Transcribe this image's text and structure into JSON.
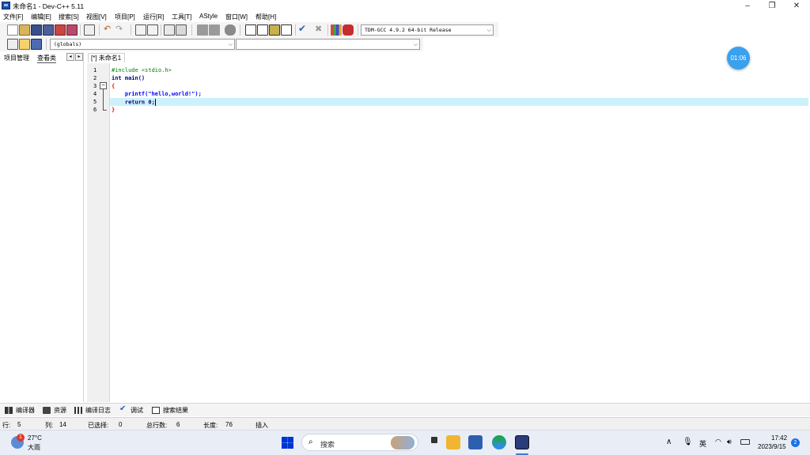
{
  "window": {
    "title": "未命名1 - Dev-C++ 5.11"
  },
  "menu": [
    "文件[F]",
    "编辑[E]",
    "搜索[S]",
    "视图[V]",
    "项目[P]",
    "运行[R]",
    "工具[T]",
    "AStyle",
    "窗口[W]",
    "帮助[H]"
  ],
  "toolbar": {
    "compiler": "TDM-GCC 4.9.2 64-bit Release",
    "scope": "(globals)",
    "symbol": ""
  },
  "left_panel": {
    "tabs": [
      "项目管理",
      "查看类"
    ],
    "nav_prev": "◂",
    "nav_next": "▸"
  },
  "editor": {
    "tab_label": "[*] 未命名1",
    "line_numbers": [
      "1",
      "2",
      "3",
      "4",
      "5",
      "6"
    ],
    "lines": [
      "#include <stdio.h>",
      "int main()",
      "{",
      "    printf(\"hello,world!\");",
      "    return 0;",
      "}"
    ],
    "current_line": 5
  },
  "timer": "01:06",
  "bottom_tabs": [
    "编译器",
    "资源",
    "编译日志",
    "调试",
    "搜索结果"
  ],
  "status": {
    "row_label": "行:",
    "row": "5",
    "col_label": "列:",
    "col": "14",
    "sel_label": "已选择:",
    "sel": "0",
    "lines_label": "总行数:",
    "lines": "6",
    "len_label": "长度:",
    "len": "76",
    "mode": "插入"
  },
  "taskbar": {
    "weather_temp": "27°C",
    "weather_desc": "大雨",
    "weather_badge": "1",
    "search_placeholder": "搜索",
    "ime": "英",
    "time": "17:42",
    "date": "2023/9/15",
    "notif_badge": "2"
  },
  "colors": {
    "current_line": "#cdf1fb",
    "timer": "#3aa1ee",
    "keyword": "#000080",
    "string": "#0000ff"
  }
}
